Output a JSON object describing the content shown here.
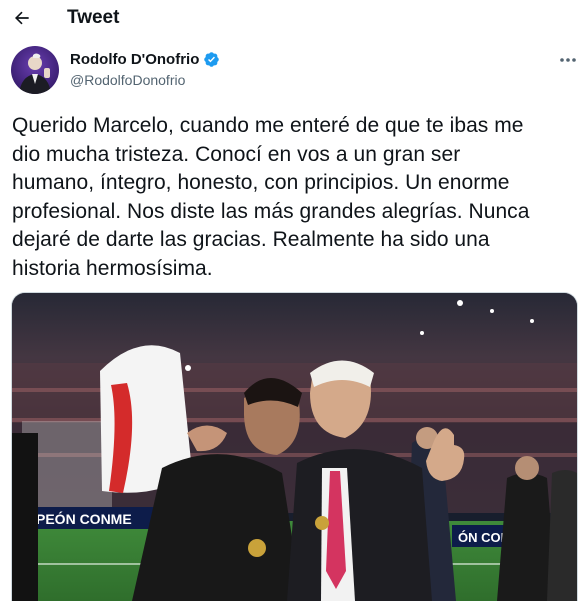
{
  "header": {
    "title": "Tweet",
    "back_icon": "arrow-left-icon"
  },
  "author": {
    "display_name": "Rodolfo D'Onofrio",
    "handle": "@RodolfoDonofrio",
    "verified_badge_color": "#1d9bf0",
    "more_icon": "more-horizontal-icon"
  },
  "tweet": {
    "text": "Querido Marcelo, cuando me enteré de que te ibas me\ndio mucha tristeza. Conocí en vos a un gran ser\nhumano, íntegro, honesto, con principios. Un enorme\nprofesional. Nos diste las más grandes alegrías. Nunca\ndejaré de darte las gracias. Realmente ha sido una\nhistoria hermosísima."
  },
  "media": {
    "board_text_left": "PEÓN CONME",
    "board_text_right": "ÓN CONME"
  },
  "colors": {
    "text_primary": "#0f1419",
    "text_secondary": "#536471",
    "border": "#cfd9de"
  }
}
